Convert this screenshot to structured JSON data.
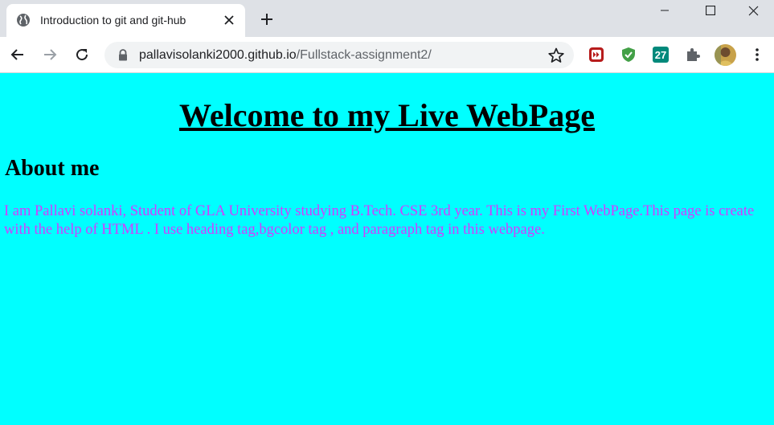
{
  "browser": {
    "tab": {
      "title": "Introduction to git and git-hub",
      "favicon": "globe-icon"
    },
    "new_tab_icon": "plus-icon",
    "window_controls": [
      "minimize-icon",
      "maximize-icon",
      "close-icon"
    ],
    "nav": [
      "back-arrow-icon",
      "forward-arrow-icon",
      "reload-icon"
    ],
    "address": {
      "host": "pallavisolanki2000.github.io",
      "path": "/Fullstack-assignment2/"
    },
    "extensions": [
      "readlater-extension-icon",
      "shield-check-extension-icon",
      "calendar-27-extension-icon",
      "puzzle-extensions-icon"
    ],
    "menu_icon": "kebab-menu-icon"
  },
  "page": {
    "background": "#00ffff",
    "heading": "Welcome to my Live WebPage",
    "subheading": "About me",
    "paragraph": "I am Pallavi solanki, Student of GLA University studying B.Tech. CSE 3rd year. This is my First WebPage.This page is create with the help of HTML . I use heading tag,bgcolor tag , and paragraph tag in this webpage.",
    "paragraph_color": "#d23cff"
  }
}
